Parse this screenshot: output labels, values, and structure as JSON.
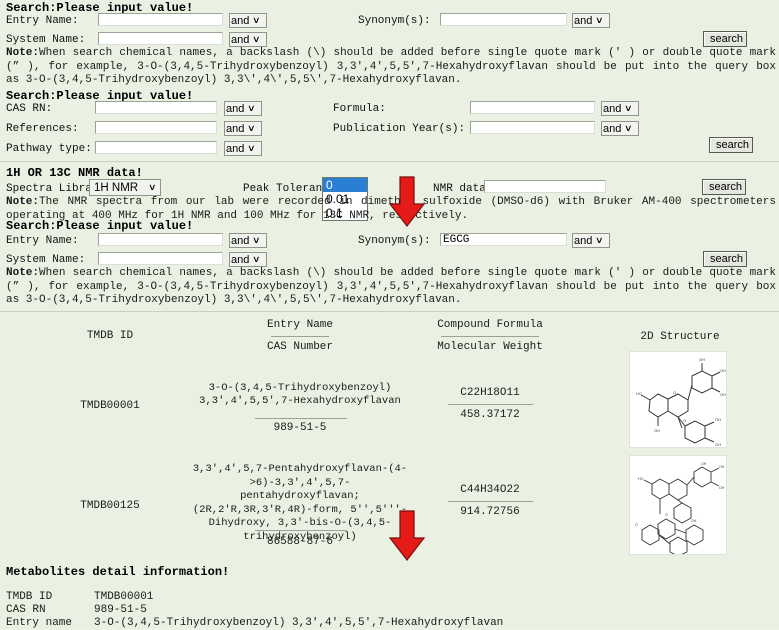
{
  "colors": {
    "page_bg": "#eaf1e3",
    "arrow_red": "#e41b18",
    "input_bg": "#ffffff",
    "select_highlight": "#2a7fd4"
  },
  "common": {
    "and_label": "and",
    "search_button": "search",
    "caret": "∨"
  },
  "section1": {
    "title": "Search:Please input value!",
    "fields": {
      "entry_name_label": "Entry Name:",
      "entry_name_value": "",
      "system_name_label": "System Name:",
      "system_name_value": "",
      "synonyms_label": "Synonym(s):",
      "synonyms_value": ""
    },
    "note_prefix": "Note:",
    "note": "When search chemical names, a backslash (\\) should be added before single quote mark (' ) or double quote mark (” ), for example, 3-O-(3,4,5-Trihydroxybenzoyl) 3,3',4',5,5',7-Hexahydroxyflavan should be put into the query box as 3-O-(3,4,5-Trihydroxybenzoyl) 3,3\\',4\\',5,5\\',7-Hexahydroxyflavan."
  },
  "section2": {
    "title": "Search:Please input value!",
    "fields": {
      "cas_rn_label": "CAS RN:",
      "cas_rn_value": "",
      "references_label": "References:",
      "references_value": "",
      "pathway_type_label": "Pathway type:",
      "pathway_type_value": "",
      "formula_label": "Formula:",
      "formula_value": "",
      "publication_year_label": "Publication Year(s):",
      "publication_year_value": ""
    }
  },
  "section3": {
    "title": "1H OR 13C NMR data!",
    "spectra_library_label": "Spectra Library:",
    "spectra_library_value": "1H NMR",
    "peak_tolerance_label": "Peak Tolerance:",
    "peak_tolerance_options": [
      "0",
      "0.01",
      "0.1"
    ],
    "peak_tolerance_selected": "0",
    "nmr_data_label": "NMR data:",
    "nmr_data_value": "",
    "note_prefix": "Note:",
    "note": "The NMR spectra from our lab were recorded in dimethyl sulfoxide (DMSO-d6) with Bruker AM-400 spectrometers operating at 400 MHz for 1H NMR and 100 MHz for 13C NMR, respectively."
  },
  "section4": {
    "title": "Search:Please input value!",
    "fields": {
      "entry_name_label": "Entry Name:",
      "entry_name_value": "",
      "system_name_label": "System Name:",
      "system_name_value": "",
      "synonyms_label": "Synonym(s):",
      "synonyms_value": "EGCG"
    },
    "note_prefix": "Note:",
    "note": "When search chemical names, a backslash (\\) should be added before single quote mark (' ) or double quote mark (” ), for example, 3-O-(3,4,5-Trihydroxybenzoyl) 3,3',4',5,5',7-Hexahydroxyflavan should be put into the query box as 3-O-(3,4,5-Trihydroxybenzoyl) 3,3\\',4\\',5,5\\',7-Hexahydroxyflavan."
  },
  "results": {
    "headers": {
      "tmdb_id": "TMDB ID",
      "entry_name": "Entry Name",
      "cas_number": "CAS Number",
      "compound_formula": "Compound Formula",
      "molecular_weight": "Molecular Weight",
      "structure": "2D Structure"
    },
    "rows": [
      {
        "tmdb_id": "TMDB00001",
        "entry_name": "3-O-(3,4,5-Trihydroxybenzoyl) 3,3',4',5,5',7-Hexahydroxyflavan",
        "cas_number": "989-51-5",
        "compound_formula": "C22H18O11",
        "molecular_weight": "458.37172"
      },
      {
        "tmdb_id": "TMDB00125",
        "entry_name": "3,3',4',5,7-Pentahydroxyflavan-(4->6)-3,3',4',5,7-pentahydroxyflavan; (2R,2'R,3R,3'R,4R)-form, 5'',5'''-Dihydroxy, 3,3'-bis-O-(3,4,5-trihydroxybenzoyl)",
        "cas_number": "86588-87-6",
        "compound_formula": "C44H34O22",
        "molecular_weight": "914.72756"
      }
    ]
  },
  "detail": {
    "title": "Metabolites detail information!",
    "rows": [
      {
        "key": "TMDB ID",
        "value": "TMDB00001"
      },
      {
        "key": "CAS RN",
        "value": "989-51-5"
      },
      {
        "key": "Entry name",
        "value": "3-O-(3,4,5-Trihydroxybenzoyl) 3,3',4',5,5',7-Hexahydroxyflavan"
      }
    ]
  }
}
